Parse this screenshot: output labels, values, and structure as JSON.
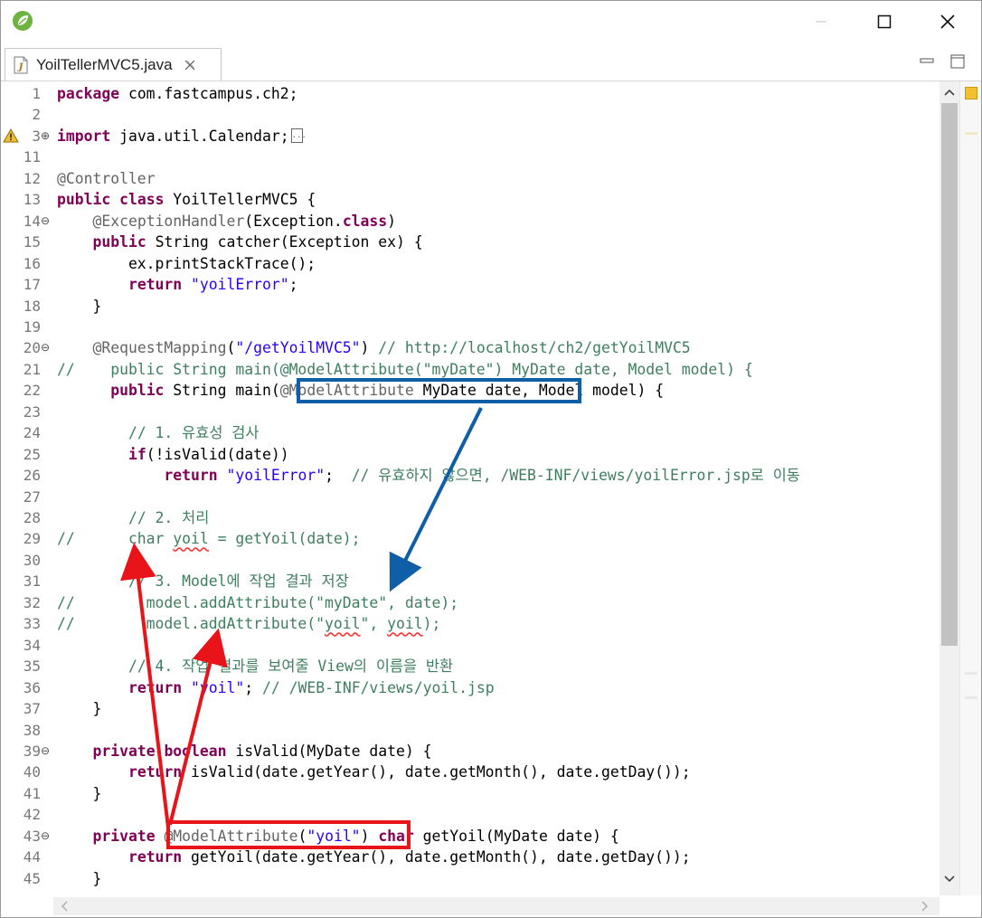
{
  "tab": {
    "title": "YoilTellerMVC5.java"
  },
  "colors": {
    "keyword": "#7f0055",
    "string": "#2a00ff",
    "comment": "#3f7f5f",
    "annotation": "#646464",
    "highlight_blue": "#0e5fa8",
    "highlight_red": "#e8141a"
  },
  "icons": {
    "app": "spring-leaf-icon",
    "file": "java-file-icon",
    "close": "close-icon",
    "minimize": "minimize-icon",
    "maximize": "maximize-icon",
    "warning": "warning-icon"
  },
  "lines": [
    {
      "num": "1",
      "fold": "",
      "tokens": [
        {
          "t": "package",
          "c": "kw"
        },
        {
          "t": " com.fastcampus.ch2;",
          "c": "plain"
        }
      ]
    },
    {
      "num": "2",
      "fold": "",
      "tokens": []
    },
    {
      "num": "3",
      "fold": "plus",
      "warn": true,
      "tokens": [
        {
          "t": "import",
          "c": "kw"
        },
        {
          "t": " java.util.Calendar;",
          "c": "plain"
        }
      ],
      "folded": true
    },
    {
      "num": "11",
      "fold": "",
      "tokens": []
    },
    {
      "num": "12",
      "fold": "",
      "tokens": [
        {
          "t": "@Controller",
          "c": "ann"
        }
      ]
    },
    {
      "num": "13",
      "fold": "",
      "tokens": [
        {
          "t": "public",
          "c": "kw"
        },
        {
          "t": " ",
          "c": "plain"
        },
        {
          "t": "class",
          "c": "kw"
        },
        {
          "t": " YoilTellerMVC5 {",
          "c": "plain"
        }
      ]
    },
    {
      "num": "14",
      "fold": "minus",
      "tokens": [
        {
          "t": "    ",
          "c": "plain"
        },
        {
          "t": "@ExceptionHandler",
          "c": "ann"
        },
        {
          "t": "(Exception.",
          "c": "plain"
        },
        {
          "t": "class",
          "c": "kw"
        },
        {
          "t": ")",
          "c": "plain"
        }
      ]
    },
    {
      "num": "15",
      "fold": "",
      "tokens": [
        {
          "t": "    ",
          "c": "plain"
        },
        {
          "t": "public",
          "c": "kw"
        },
        {
          "t": " String catcher(Exception ex) {",
          "c": "plain"
        }
      ]
    },
    {
      "num": "16",
      "fold": "",
      "tokens": [
        {
          "t": "        ex.printStackTrace();",
          "c": "plain"
        }
      ]
    },
    {
      "num": "17",
      "fold": "",
      "tokens": [
        {
          "t": "        ",
          "c": "plain"
        },
        {
          "t": "return",
          "c": "kw"
        },
        {
          "t": " ",
          "c": "plain"
        },
        {
          "t": "\"yoilError\"",
          "c": "str"
        },
        {
          "t": ";",
          "c": "plain"
        }
      ]
    },
    {
      "num": "18",
      "fold": "",
      "tokens": [
        {
          "t": "    }",
          "c": "plain"
        }
      ]
    },
    {
      "num": "19",
      "fold": "",
      "tokens": []
    },
    {
      "num": "20",
      "fold": "minus",
      "tokens": [
        {
          "t": "    ",
          "c": "plain"
        },
        {
          "t": "@RequestMapping",
          "c": "ann"
        },
        {
          "t": "(",
          "c": "plain"
        },
        {
          "t": "\"/getYoilMVC5\"",
          "c": "str"
        },
        {
          "t": ") ",
          "c": "plain"
        },
        {
          "t": "// http://localhost/ch2/getYoilMVC5",
          "c": "cmt"
        }
      ]
    },
    {
      "num": "21",
      "fold": "",
      "tokens": [
        {
          "t": "//    public String main(@ModelAttribute(\"myDate\") MyDate date, Model model) {",
          "c": "cmt"
        }
      ]
    },
    {
      "num": "22",
      "fold": "",
      "tokens": [
        {
          "t": "      ",
          "c": "plain"
        },
        {
          "t": "public",
          "c": "kw"
        },
        {
          "t": " String main(",
          "c": "plain"
        },
        {
          "t": "@ModelAttribute",
          "c": "ann"
        },
        {
          "t": " MyDate date, Model model) {",
          "c": "plain"
        }
      ]
    },
    {
      "num": "23",
      "fold": "",
      "tokens": []
    },
    {
      "num": "24",
      "fold": "",
      "tokens": [
        {
          "t": "        ",
          "c": "plain"
        },
        {
          "t": "// 1. 유효성 검사",
          "c": "cmt"
        }
      ]
    },
    {
      "num": "25",
      "fold": "",
      "tokens": [
        {
          "t": "        ",
          "c": "plain"
        },
        {
          "t": "if",
          "c": "kw"
        },
        {
          "t": "(!isValid(date))",
          "c": "plain"
        }
      ]
    },
    {
      "num": "26",
      "fold": "",
      "tokens": [
        {
          "t": "            ",
          "c": "plain"
        },
        {
          "t": "return",
          "c": "kw"
        },
        {
          "t": " ",
          "c": "plain"
        },
        {
          "t": "\"yoilError\"",
          "c": "str"
        },
        {
          "t": ";  ",
          "c": "plain"
        },
        {
          "t": "// 유효하지 않으면, /WEB-INF/views/yoilError.jsp로 이동",
          "c": "cmt"
        }
      ]
    },
    {
      "num": "27",
      "fold": "",
      "tokens": []
    },
    {
      "num": "28",
      "fold": "",
      "tokens": [
        {
          "t": "        ",
          "c": "plain"
        },
        {
          "t": "// 2. 처리",
          "c": "cmt"
        }
      ]
    },
    {
      "num": "29",
      "fold": "",
      "tokens": [
        {
          "t": "//      char ",
          "c": "cmt"
        },
        {
          "t": "yoil",
          "c": "cmt",
          "sq": true
        },
        {
          "t": " = getYoil(date);",
          "c": "cmt"
        }
      ]
    },
    {
      "num": "30",
      "fold": "",
      "tokens": []
    },
    {
      "num": "31",
      "fold": "",
      "tokens": [
        {
          "t": "        ",
          "c": "plain"
        },
        {
          "t": "// 3. Model에 작업 결과 저장",
          "c": "cmt"
        }
      ]
    },
    {
      "num": "32",
      "fold": "",
      "tokens": [
        {
          "t": "//        model.addAttribute(\"myDate\", date);",
          "c": "cmt"
        }
      ]
    },
    {
      "num": "33",
      "fold": "",
      "tokens": [
        {
          "t": "//        model.addAttribute(\"",
          "c": "cmt"
        },
        {
          "t": "yoil",
          "c": "cmt",
          "sq": true
        },
        {
          "t": "\", ",
          "c": "cmt"
        },
        {
          "t": "yoil",
          "c": "cmt",
          "sq": true
        },
        {
          "t": ");",
          "c": "cmt"
        }
      ]
    },
    {
      "num": "34",
      "fold": "",
      "tokens": []
    },
    {
      "num": "35",
      "fold": "",
      "tokens": [
        {
          "t": "        ",
          "c": "plain"
        },
        {
          "t": "// 4. 작업 결과를 보여줄 View의 이름을 반환",
          "c": "cmt"
        }
      ]
    },
    {
      "num": "36",
      "fold": "",
      "tokens": [
        {
          "t": "        ",
          "c": "plain"
        },
        {
          "t": "return",
          "c": "kw"
        },
        {
          "t": " ",
          "c": "plain"
        },
        {
          "t": "\"yoil\"",
          "c": "str"
        },
        {
          "t": "; ",
          "c": "plain"
        },
        {
          "t": "// /WEB-INF/views/yoil.jsp",
          "c": "cmt"
        }
      ]
    },
    {
      "num": "37",
      "fold": "",
      "tokens": [
        {
          "t": "    }",
          "c": "plain"
        }
      ]
    },
    {
      "num": "38",
      "fold": "",
      "tokens": []
    },
    {
      "num": "39",
      "fold": "minus",
      "tokens": [
        {
          "t": "    ",
          "c": "plain"
        },
        {
          "t": "private",
          "c": "kw"
        },
        {
          "t": " ",
          "c": "plain"
        },
        {
          "t": "boolean",
          "c": "kw"
        },
        {
          "t": " isValid(MyDate date) {",
          "c": "plain"
        }
      ]
    },
    {
      "num": "40",
      "fold": "",
      "tokens": [
        {
          "t": "        ",
          "c": "plain"
        },
        {
          "t": "return",
          "c": "kw"
        },
        {
          "t": " isValid(date.getYear(), date.getMonth(), date.getDay());",
          "c": "plain"
        }
      ]
    },
    {
      "num": "41",
      "fold": "",
      "tokens": [
        {
          "t": "    }",
          "c": "plain"
        }
      ]
    },
    {
      "num": "42",
      "fold": "",
      "tokens": []
    },
    {
      "num": "43",
      "fold": "minus",
      "tokens": [
        {
          "t": "    ",
          "c": "plain"
        },
        {
          "t": "private",
          "c": "kw"
        },
        {
          "t": " ",
          "c": "plain"
        },
        {
          "t": "@ModelAttribute",
          "c": "ann"
        },
        {
          "t": "(",
          "c": "plain"
        },
        {
          "t": "\"yoil\"",
          "c": "str"
        },
        {
          "t": ") ",
          "c": "plain"
        },
        {
          "t": "char",
          "c": "kw"
        },
        {
          "t": " getYoil(MyDate date) {",
          "c": "plain"
        }
      ]
    },
    {
      "num": "44",
      "fold": "",
      "tokens": [
        {
          "t": "        ",
          "c": "plain"
        },
        {
          "t": "return",
          "c": "kw"
        },
        {
          "t": " getYoil(date.getYear(), date.getMonth(), date.getDay());",
          "c": "plain"
        }
      ]
    },
    {
      "num": "45",
      "fold": "",
      "tokens": [
        {
          "t": "    }",
          "c": "plain"
        }
      ]
    }
  ]
}
